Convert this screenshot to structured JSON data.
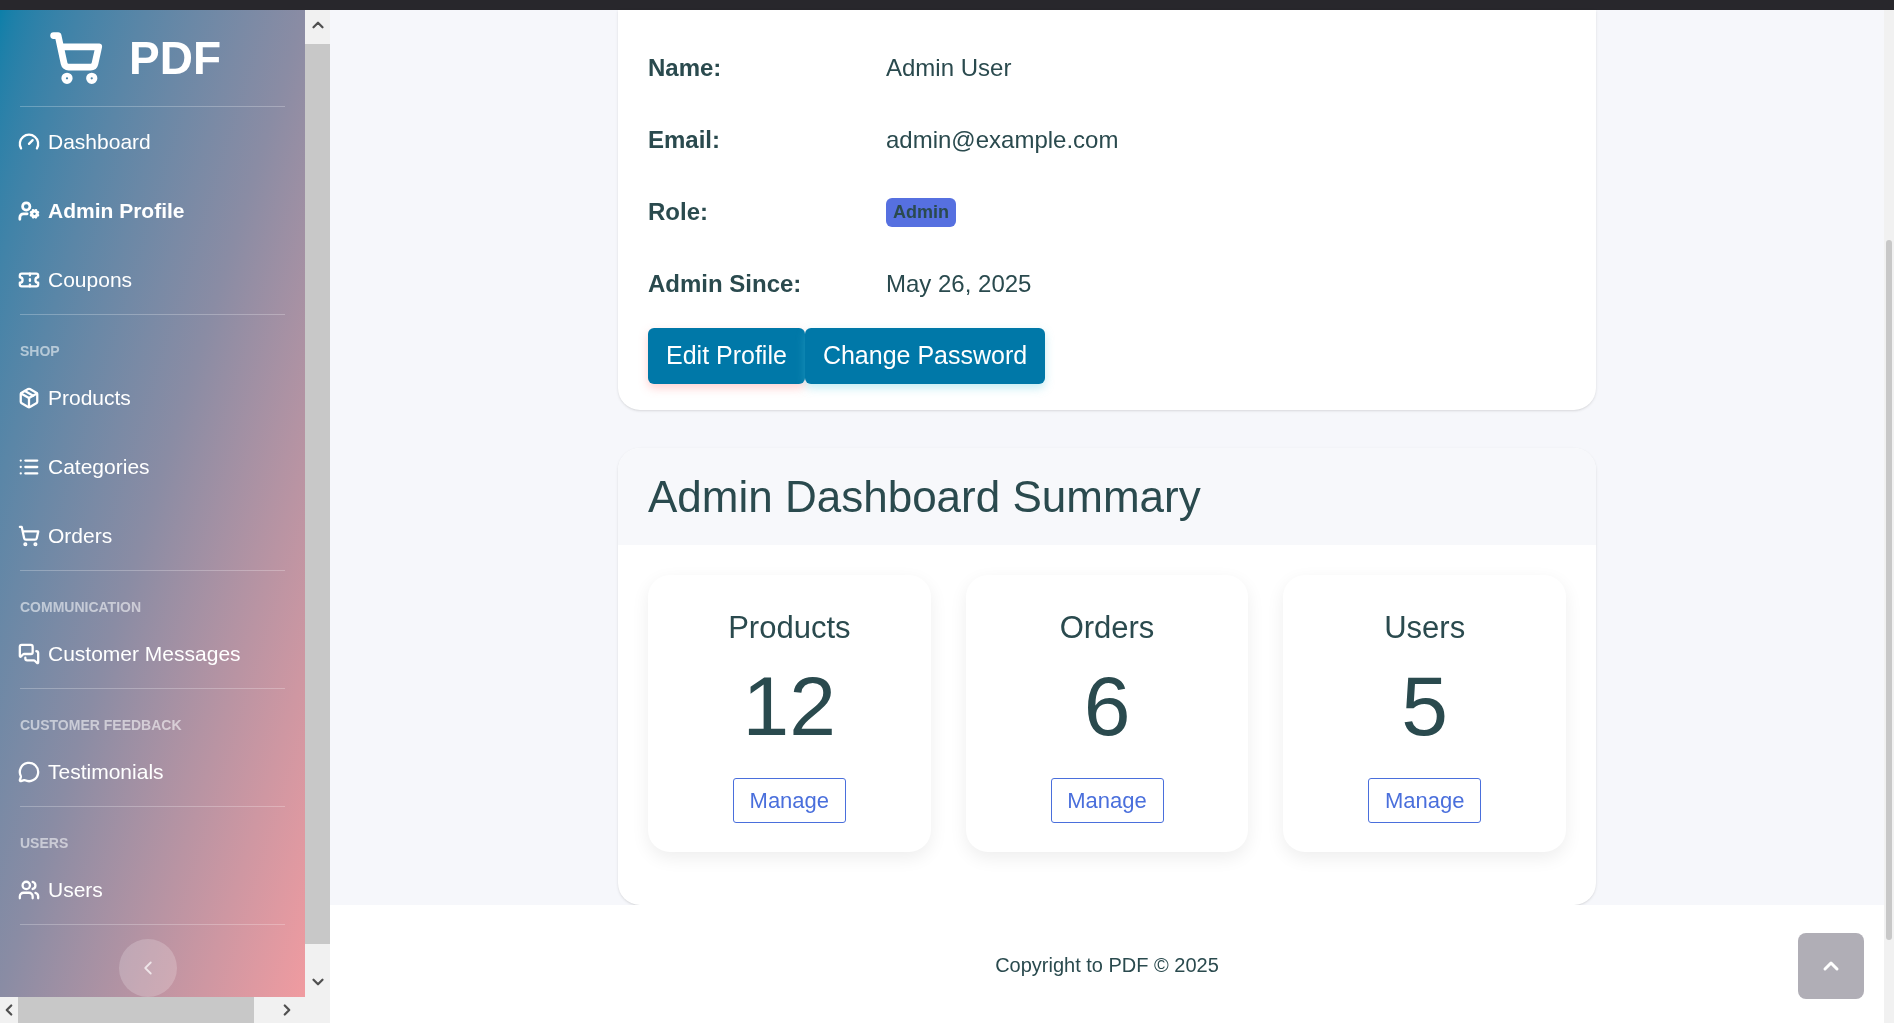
{
  "sidebar": {
    "brand": "PDF",
    "groups": [
      {
        "items": [
          {
            "label": "Dashboard",
            "selected": false
          },
          {
            "label": "Admin Profile",
            "selected": true
          },
          {
            "label": "Coupons",
            "selected": false
          }
        ]
      },
      {
        "heading": "SHOP",
        "items": [
          {
            "label": "Products",
            "selected": false
          },
          {
            "label": "Categories",
            "selected": false
          },
          {
            "label": "Orders",
            "selected": false
          }
        ]
      },
      {
        "heading": "COMMUNICATION",
        "items": [
          {
            "label": "Customer Messages",
            "selected": false
          }
        ]
      },
      {
        "heading": "CUSTOMER FEEDBACK",
        "items": [
          {
            "label": "Testimonials",
            "selected": false
          }
        ]
      },
      {
        "heading": "USERS",
        "items": [
          {
            "label": "Users",
            "selected": false
          }
        ]
      }
    ]
  },
  "profile": {
    "fields": [
      {
        "label": "Name:",
        "value": "Admin User",
        "kind": "text"
      },
      {
        "label": "Email:",
        "value": "admin@example.com",
        "kind": "text"
      },
      {
        "label": "Role:",
        "value": "Admin",
        "kind": "badge"
      },
      {
        "label": "Admin Since:",
        "value": "May 26, 2025",
        "kind": "text"
      }
    ],
    "buttons": [
      "Edit Profile",
      "Change Password"
    ]
  },
  "summary": {
    "title": "Admin Dashboard Summary",
    "stats": [
      {
        "label": "Products",
        "value": "12",
        "button": "Manage"
      },
      {
        "label": "Orders",
        "value": "6",
        "button": "Manage"
      },
      {
        "label": "Users",
        "value": "5",
        "button": "Manage"
      }
    ]
  },
  "footer": "Copyright to PDF © 2025"
}
